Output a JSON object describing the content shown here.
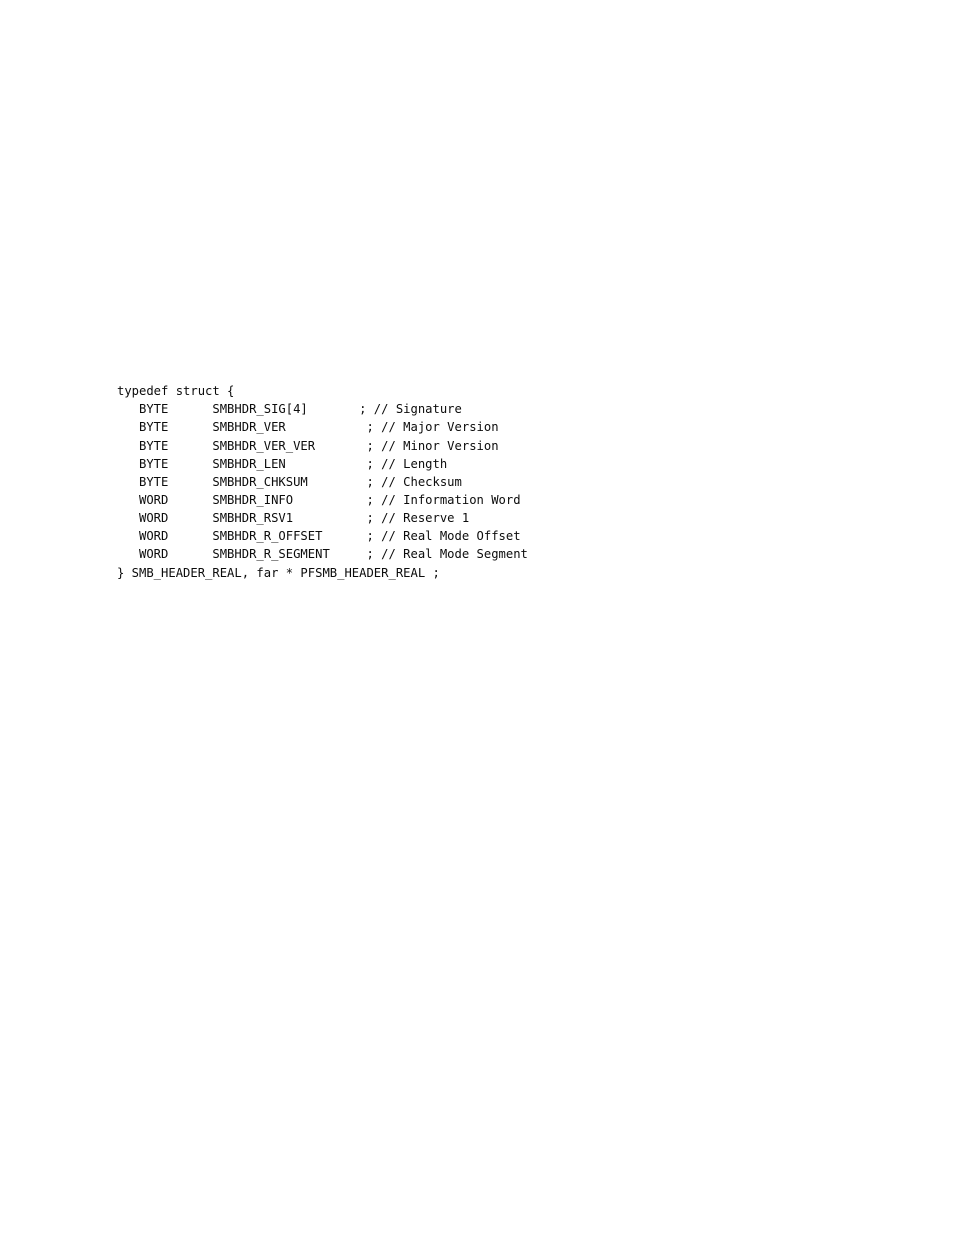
{
  "document": {
    "page_background": "#ffffff",
    "text_color": "#0c0c0c",
    "code": {
      "language": "c",
      "declaration_keyword": "typedef struct {",
      "closing_line": "} SMB_HEADER_REAL, far * PFSMB_HEADER_REAL ;",
      "struct_name": "SMB_HEADER_REAL",
      "pointer_typedef_name": "PFSMB_HEADER_REAL",
      "fields": [
        {
          "type": "BYTE",
          "name": "SMBHDR_SIG[4]",
          "terminator": ";",
          "comment": "// Signature"
        },
        {
          "type": "BYTE",
          "name": "SMBHDR_VER",
          "terminator": ";",
          "comment": "// Major Version"
        },
        {
          "type": "BYTE",
          "name": "SMBHDR_VER_VER",
          "terminator": ";",
          "comment": "// Minor Version"
        },
        {
          "type": "BYTE",
          "name": "SMBHDR_LEN",
          "terminator": ";",
          "comment": "// Length"
        },
        {
          "type": "BYTE",
          "name": "SMBHDR_CHKSUM",
          "terminator": ";",
          "comment": "// Checksum"
        },
        {
          "type": "WORD",
          "name": "SMBHDR_INFO",
          "terminator": ";",
          "comment": "// Information Word"
        },
        {
          "type": "WORD",
          "name": "SMBHDR_RSV1",
          "terminator": ";",
          "comment": "// Reserve 1"
        },
        {
          "type": "WORD",
          "name": "SMBHDR_R_OFFSET",
          "terminator": ";",
          "comment": "// Real Mode Offset"
        },
        {
          "type": "WORD",
          "name": "SMBHDR_R_SEGMENT",
          "terminator": ";",
          "comment": "// Real Mode Segment"
        }
      ],
      "lines": [
        "typedef struct {",
        "   BYTE      SMBHDR_SIG[4]       ; // Signature",
        "   BYTE      SMBHDR_VER           ; // Major Version",
        "   BYTE      SMBHDR_VER_VER       ; // Minor Version",
        "   BYTE      SMBHDR_LEN           ; // Length",
        "   BYTE      SMBHDR_CHKSUM        ; // Checksum",
        "   WORD      SMBHDR_INFO          ; // Information Word",
        "   WORD      SMBHDR_RSV1          ; // Reserve 1",
        "   WORD      SMBHDR_R_OFFSET      ; // Real Mode Offset",
        "   WORD      SMBHDR_R_SEGMENT     ; // Real Mode Segment",
        "} SMB_HEADER_REAL, far * PFSMB_HEADER_REAL ;"
      ]
    }
  }
}
